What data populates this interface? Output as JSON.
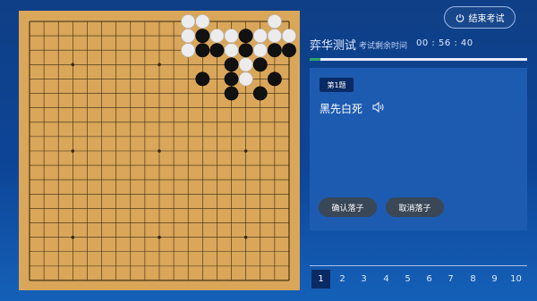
{
  "header": {
    "end_button_label": "结束考试",
    "title": "弈华测试",
    "timer_label": "考试剩余时间",
    "timer_value": "00 : 56 : 40",
    "progress_fraction": 0.05
  },
  "colors": {
    "board": "#d9a65a",
    "grid_line": "#3a2a12",
    "black_stone": "#111111",
    "white_stone": "#ececec",
    "panel": "#1d5bb1",
    "accent_dark": "#0a2a63",
    "progress": "#2ea46b"
  },
  "question": {
    "tag": "第1题",
    "text": "黑先白死",
    "icon": "speaker-icon"
  },
  "actions": {
    "confirm_label": "确认落子",
    "cancel_label": "取消落子"
  },
  "pagination": {
    "pages": [
      "1",
      "2",
      "3",
      "4",
      "5",
      "6",
      "7",
      "8",
      "9",
      "10"
    ],
    "active_index": 0
  },
  "board": {
    "size": 19,
    "stones": [
      {
        "col": 11,
        "row": 0,
        "color": "white"
      },
      {
        "col": 12,
        "row": 0,
        "color": "white"
      },
      {
        "col": 17,
        "row": 0,
        "color": "white"
      },
      {
        "col": 11,
        "row": 1,
        "color": "white"
      },
      {
        "col": 12,
        "row": 1,
        "color": "black"
      },
      {
        "col": 13,
        "row": 1,
        "color": "white"
      },
      {
        "col": 14,
        "row": 1,
        "color": "white"
      },
      {
        "col": 15,
        "row": 1,
        "color": "black"
      },
      {
        "col": 16,
        "row": 1,
        "color": "white"
      },
      {
        "col": 17,
        "row": 1,
        "color": "white"
      },
      {
        "col": 18,
        "row": 1,
        "color": "white"
      },
      {
        "col": 11,
        "row": 2,
        "color": "white"
      },
      {
        "col": 12,
        "row": 2,
        "color": "black"
      },
      {
        "col": 13,
        "row": 2,
        "color": "black"
      },
      {
        "col": 14,
        "row": 2,
        "color": "white"
      },
      {
        "col": 15,
        "row": 2,
        "color": "black"
      },
      {
        "col": 16,
        "row": 2,
        "color": "white"
      },
      {
        "col": 17,
        "row": 2,
        "color": "black"
      },
      {
        "col": 18,
        "row": 2,
        "color": "black"
      },
      {
        "col": 14,
        "row": 3,
        "color": "black"
      },
      {
        "col": 15,
        "row": 3,
        "color": "white"
      },
      {
        "col": 16,
        "row": 3,
        "color": "black"
      },
      {
        "col": 12,
        "row": 4,
        "color": "black"
      },
      {
        "col": 14,
        "row": 4,
        "color": "black"
      },
      {
        "col": 15,
        "row": 4,
        "color": "white"
      },
      {
        "col": 17,
        "row": 4,
        "color": "black"
      },
      {
        "col": 14,
        "row": 5,
        "color": "black"
      },
      {
        "col": 16,
        "row": 5,
        "color": "black"
      }
    ],
    "star_points": [
      [
        3,
        3
      ],
      [
        9,
        3
      ],
      [
        15,
        3
      ],
      [
        3,
        9
      ],
      [
        9,
        9
      ],
      [
        15,
        9
      ],
      [
        3,
        15
      ],
      [
        9,
        15
      ],
      [
        15,
        15
      ]
    ]
  }
}
